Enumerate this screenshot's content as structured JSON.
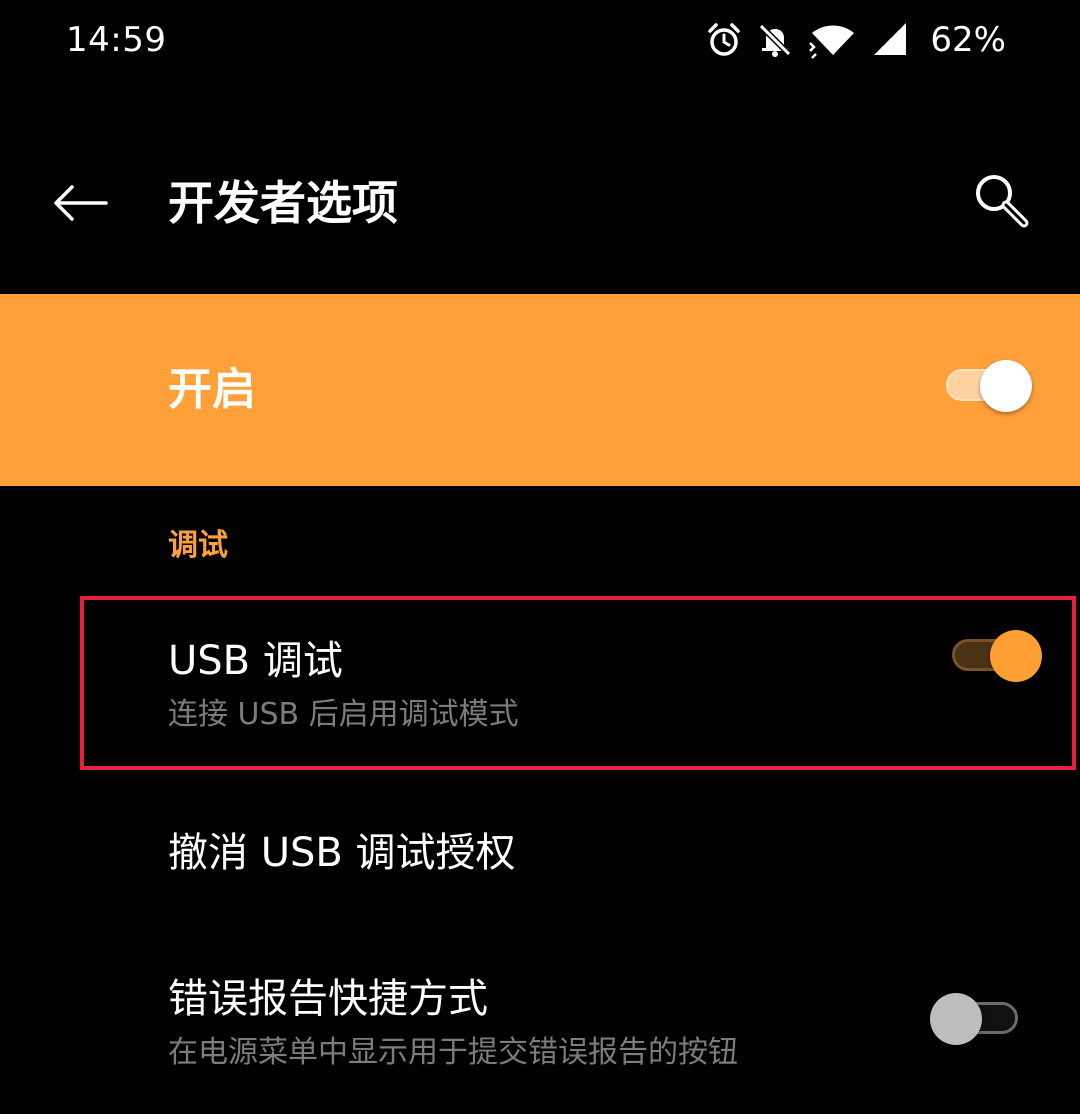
{
  "status_bar": {
    "time": "14:59",
    "battery": "62%",
    "icons": [
      "alarm-icon",
      "bell-off-icon",
      "wifi-icon",
      "signal-icon"
    ]
  },
  "app_bar": {
    "title": "开发者选项",
    "back_icon": "arrow-left-icon",
    "search_icon": "search-icon"
  },
  "master_switch": {
    "label": "开启",
    "checked": true
  },
  "section": {
    "header": "调试"
  },
  "settings": {
    "usb_debugging": {
      "title": "USB 调试",
      "summary": "连接 USB 后启用调试模式",
      "checked": true
    },
    "revoke_usb": {
      "title": "撤消 USB 调试授权"
    },
    "bug_report": {
      "title": "错误报告快捷方式",
      "summary": "在电源菜单中显示用于提交错误报告的按钮",
      "checked": false
    }
  },
  "colors": {
    "background": "#000000",
    "accent": "#ffa038",
    "highlight": "#e8203d",
    "secondary_text": "#7c7c7c"
  }
}
